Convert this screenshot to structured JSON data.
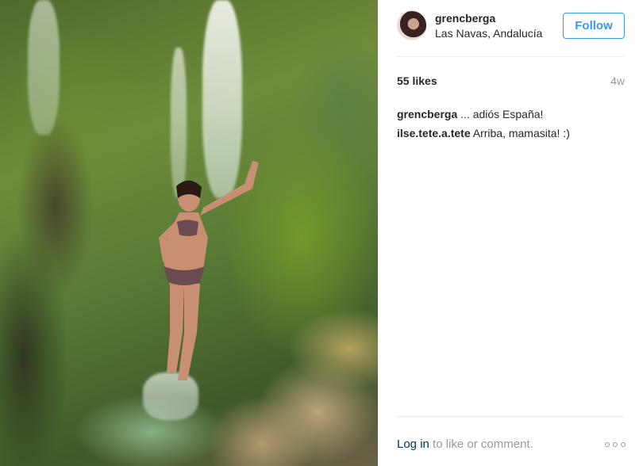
{
  "post": {
    "image_alt": "Photo of a woman standing beneath a waterfall on a moss-covered rock wall"
  },
  "header": {
    "username": "grencberga",
    "location": "Las Navas, Andalucía",
    "follow_label": "Follow"
  },
  "stats": {
    "likes": "55 likes",
    "age": "4w"
  },
  "comments": [
    {
      "user": "grencberga",
      "text": "... adiós España!"
    },
    {
      "user": "ilse.tete.a.tete",
      "text": "Arriba, mamasita! :)"
    }
  ],
  "footer": {
    "login_label": "Log in",
    "rest": " to like or comment."
  },
  "colors": {
    "accent": "#3897f0",
    "text": "#262626",
    "muted": "#999999",
    "link": "#003569"
  }
}
